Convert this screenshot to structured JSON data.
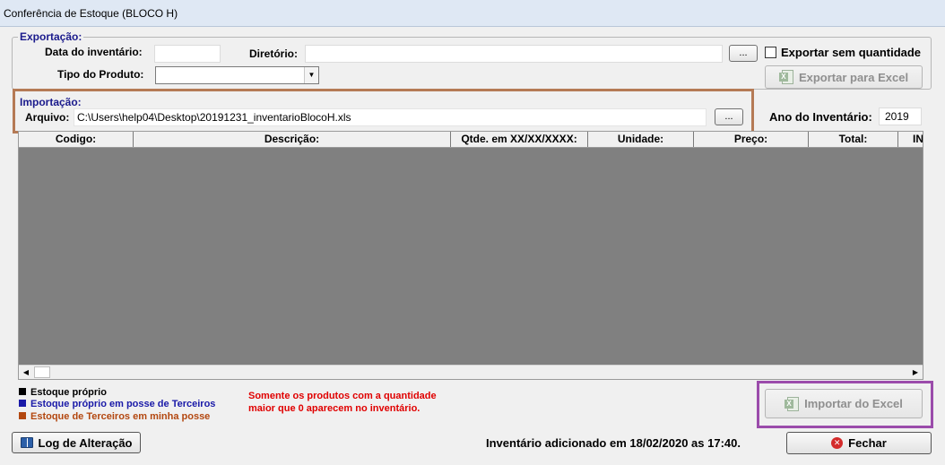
{
  "window": {
    "title": "Conferência de Estoque (BLOCO H)"
  },
  "exportacao": {
    "legend": "Exportação:",
    "data_label": "Data do inventário:",
    "data_value": "",
    "diretorio_label": "Diretório:",
    "diretorio_value": "",
    "browse_label": "...",
    "exportar_sem_qtd_label": "Exportar sem quantidade",
    "tipo_produto_label": "Tipo do Produto:",
    "tipo_produto_value": "",
    "exportar_excel_label": "Exportar para Excel"
  },
  "importacao": {
    "legend": "Importação:",
    "arquivo_label": "Arquivo:",
    "arquivo_value": "C:\\Users\\help04\\Desktop\\20191231_inventarioBlocoH.xls",
    "browse_label": "...",
    "ano_label": "Ano do Inventário:",
    "ano_value": "2019"
  },
  "grid": {
    "columns": [
      "Codigo:",
      "Descrição:",
      "Qtde. em XX/XX/XXXX:",
      "Unidade:",
      "Preço:",
      "Total:",
      "IN"
    ]
  },
  "legend_items": [
    {
      "label": "Estoque próprio",
      "color": "#000000"
    },
    {
      "label": "Estoque próprio em posse de Terceiros",
      "color": "#1a1aa8"
    },
    {
      "label": "Estoque de Terceiros em minha posse",
      "color": "#b3470f"
    }
  ],
  "note": {
    "line1": "Somente os produtos com a quantidade",
    "line2": "maior que 0 aparecem no inventário.",
    "color": "#e00000"
  },
  "buttons": {
    "importar_excel": "Importar do Excel",
    "log_alteracao": "Log de Alteração",
    "fechar": "Fechar"
  },
  "status": "Inventário adicionado em 18/02/2020 as 17:40."
}
